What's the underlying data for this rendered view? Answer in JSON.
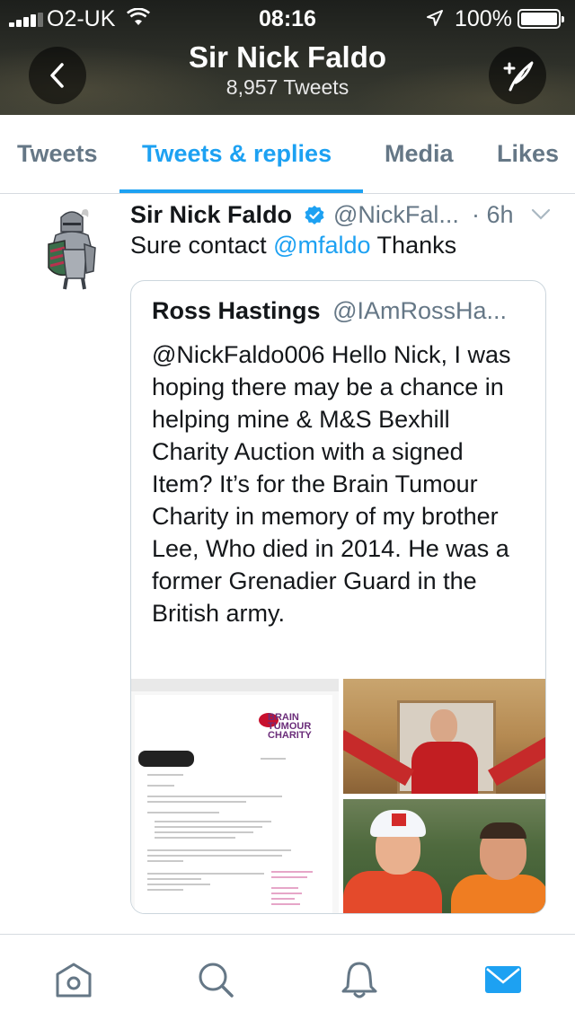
{
  "status_bar": {
    "carrier": "O2-UK",
    "time": "08:16",
    "battery": "100%",
    "icons": [
      "signal-icon",
      "wifi-icon",
      "location-arrow-icon",
      "battery-icon"
    ]
  },
  "header": {
    "title": "Sir Nick Faldo",
    "tweet_count": "8,957 Tweets",
    "back_icon": "chevron-left-icon",
    "compose_icon": "compose-tweet-icon"
  },
  "tabs": [
    {
      "label": "Tweets",
      "active": false
    },
    {
      "label": "Tweets & replies",
      "active": true
    },
    {
      "label": "Media",
      "active": false
    },
    {
      "label": "Likes",
      "active": false
    }
  ],
  "tweet": {
    "author": "Sir Nick Faldo",
    "handle": "@NickFal...",
    "time": "· 6h",
    "text_prefix": "Sure contact ",
    "mention": "@mfaldo",
    "text_suffix": " Thanks",
    "quoted": {
      "author": "Ross Hastings",
      "handle": "@IAmRossHa...",
      "text": "@NickFaldo006 Hello Nick, I was hoping there may be a chance in helping mine & M&S Bexhill Charity Auction with a signed Item? It’s for the Brain Tumour Charity in memory of my brother Lee, Who died in 2014. He was a former Grenadier Guard in the British army."
    }
  },
  "bottom_nav": [
    {
      "name": "home",
      "icon": "home-icon",
      "active": false
    },
    {
      "name": "search",
      "icon": "search-icon",
      "active": false
    },
    {
      "name": "notifications",
      "icon": "bell-icon",
      "active": false
    },
    {
      "name": "messages",
      "icon": "envelope-icon",
      "active": true
    }
  ],
  "colors": {
    "accent": "#1da1f2",
    "text": "#14171a",
    "secondary": "#657786",
    "nav_inactive": "#657786"
  }
}
